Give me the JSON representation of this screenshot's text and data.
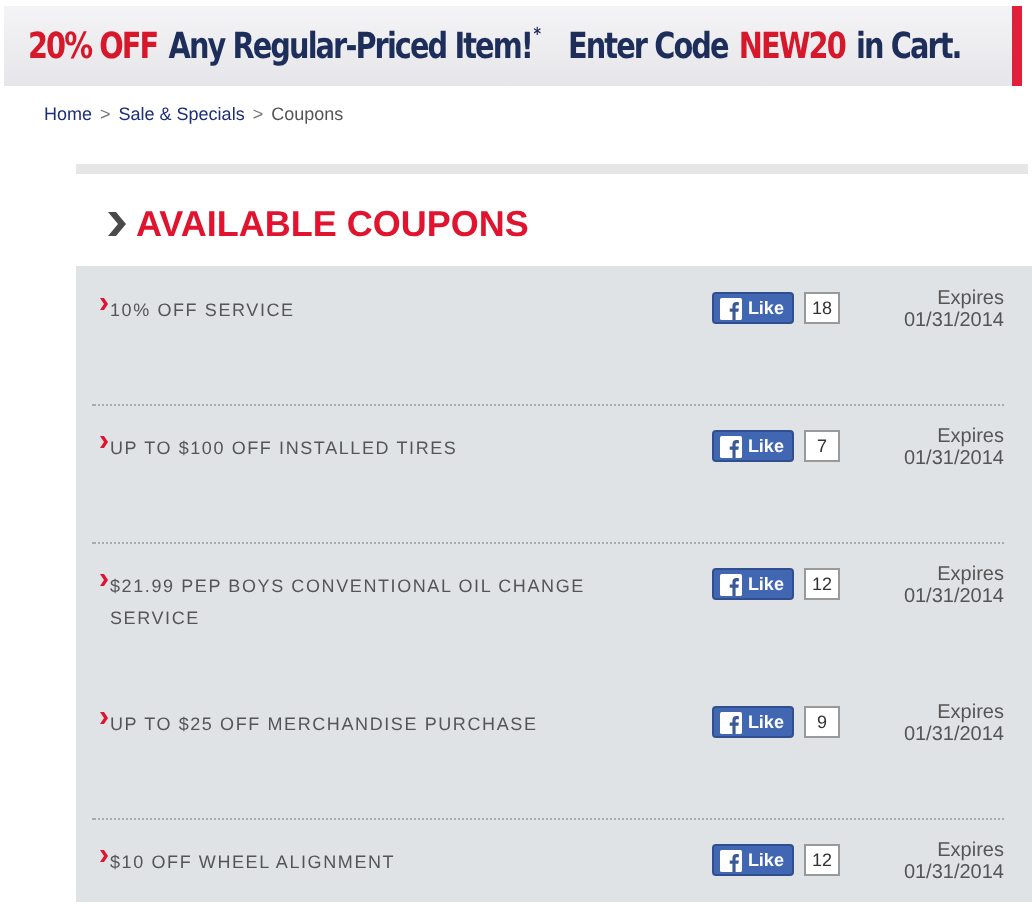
{
  "banner": {
    "segments": [
      {
        "text": "20% OFF",
        "kind": "highlight"
      },
      {
        "text": "Any Regular-Priced Item!",
        "kind": "plain"
      },
      {
        "text": "*",
        "kind": "mark"
      },
      {
        "text": "Enter Code",
        "kind": "plain"
      },
      {
        "text": "NEW20",
        "kind": "highlight"
      },
      {
        "text": "in Cart.",
        "kind": "plain"
      }
    ]
  },
  "breadcrumb": [
    {
      "label": "Home",
      "kind": "link"
    },
    {
      "label": "Sale & Specials",
      "kind": "link"
    },
    {
      "label": "Coupons",
      "kind": "current"
    }
  ],
  "breadcrumb_separator": ">",
  "heading": "AVAILABLE COUPONS",
  "coupons": [
    {
      "title": "10% OFF SERVICE",
      "like_label": "Like",
      "likes": "18",
      "expires_label": "Expires",
      "expires": "01/31/2014",
      "divider_above": false
    },
    {
      "title": "UP TO $100 OFF INSTALLED TIRES",
      "like_label": "Like",
      "likes": "7",
      "expires_label": "Expires",
      "expires": "01/31/2014",
      "divider_above": true
    },
    {
      "title": "$21.99 PEP BOYS CONVENTIONAL OIL CHANGE SERVICE",
      "like_label": "Like",
      "likes": "12",
      "expires_label": "Expires",
      "expires": "01/31/2014",
      "divider_above": true
    },
    {
      "title": "UP TO $25 OFF MERCHANDISE PURCHASE",
      "like_label": "Like",
      "likes": "9",
      "expires_label": "Expires",
      "expires": "01/31/2014",
      "divider_above": false
    },
    {
      "title": "$10 OFF WHEEL ALIGNMENT",
      "like_label": "Like",
      "likes": "12",
      "expires_label": "Expires",
      "expires": "01/31/2014",
      "divider_above": true
    }
  ]
}
